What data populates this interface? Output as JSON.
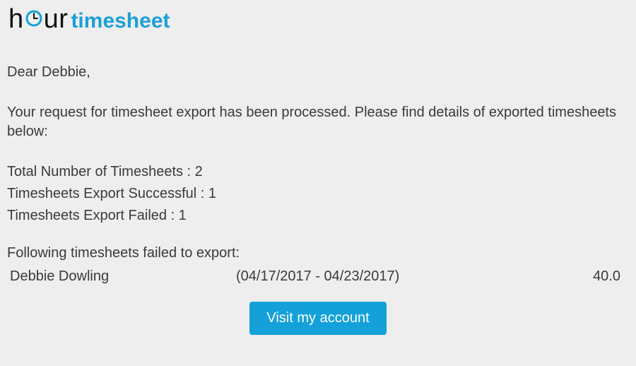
{
  "logo": {
    "part1": "h",
    "part2": "ur",
    "part3": "timesheet"
  },
  "greeting": "Dear Debbie,",
  "intro": "Your request for timesheet export has been processed. Please find details of exported timesheets below:",
  "stats": {
    "total": "Total Number of Timesheets : 2",
    "success": "Timesheets Export Successful : 1",
    "failed": "Timesheets Export Failed : 1"
  },
  "failed_heading": "Following timesheets failed to export:",
  "failed_rows": [
    {
      "name": "Debbie Dowling",
      "range": "(04/17/2017 - 04/23/2017)",
      "hours": "40.0"
    }
  ],
  "cta_label": "Visit my account"
}
